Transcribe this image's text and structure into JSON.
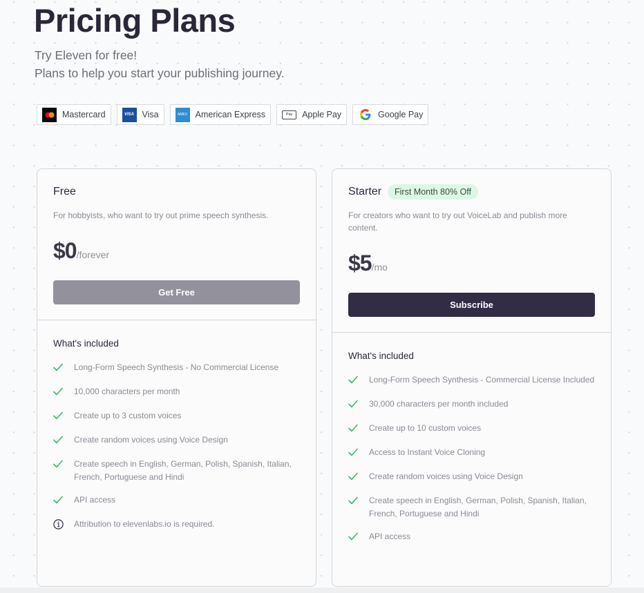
{
  "header": {
    "title": "Pricing Plans",
    "subtitle_lines": [
      "Try Eleven for free!",
      "Plans to help you start your publishing journey."
    ]
  },
  "payment_methods": [
    {
      "label": "Mastercard",
      "icon": "mastercard-icon"
    },
    {
      "label": "Visa",
      "icon": "visa-icon",
      "icon_text": "VISA"
    },
    {
      "label": "American Express",
      "icon": "amex-icon",
      "icon_text": "AMEX"
    },
    {
      "label": "Apple Pay",
      "icon": "apple-pay-icon",
      "icon_text": "Pay"
    },
    {
      "label": "Google Pay",
      "icon": "google-icon",
      "icon_text": "G"
    }
  ],
  "plans": [
    {
      "name": "Free",
      "badge": null,
      "description": "For hobbyists, who want to try out prime speech synthesis.",
      "price": "$0",
      "price_unit": "/forever",
      "cta_label": "Get Free",
      "included_title": "What's included",
      "features": [
        {
          "icon": "check",
          "text": "Long-Form Speech Synthesis - No Commercial License"
        },
        {
          "icon": "check",
          "text": "10,000 characters per month"
        },
        {
          "icon": "check",
          "text": "Create up to 3 custom voices"
        },
        {
          "icon": "check",
          "text": "Create random voices using Voice Design"
        },
        {
          "icon": "check",
          "text": "Create speech in English, German, Polish, Spanish, Italian, French, Portuguese and Hindi"
        },
        {
          "icon": "check",
          "text": "API access"
        },
        {
          "icon": "info",
          "text": "Attribution to elevenlabs.io is required."
        }
      ]
    },
    {
      "name": "Starter",
      "badge": "First Month 80% Off",
      "description": "For creators who want to try out VoiceLab and publish more content.",
      "price": "$5",
      "price_unit": "/mo",
      "cta_label": "Subscribe",
      "included_title": "What's included",
      "features": [
        {
          "icon": "check",
          "text": "Long-Form Speech Synthesis - Commercial License Included"
        },
        {
          "icon": "check",
          "text": "30,000 characters per month included"
        },
        {
          "icon": "check",
          "text": "Create up to 10 custom voices"
        },
        {
          "icon": "check",
          "text": "Access to Instant Voice Cloning"
        },
        {
          "icon": "check",
          "text": "Create random voices using Voice Design"
        },
        {
          "icon": "check",
          "text": "Create speech in English, German, Polish, Spanish, Italian, French, Portuguese and Hindi"
        },
        {
          "icon": "check",
          "text": "API access"
        }
      ]
    }
  ],
  "colors": {
    "check": "#3bb56b",
    "badge_bg": "#dcf7e5",
    "primary_button": "#322c44",
    "disabled_button": "#93929c"
  }
}
